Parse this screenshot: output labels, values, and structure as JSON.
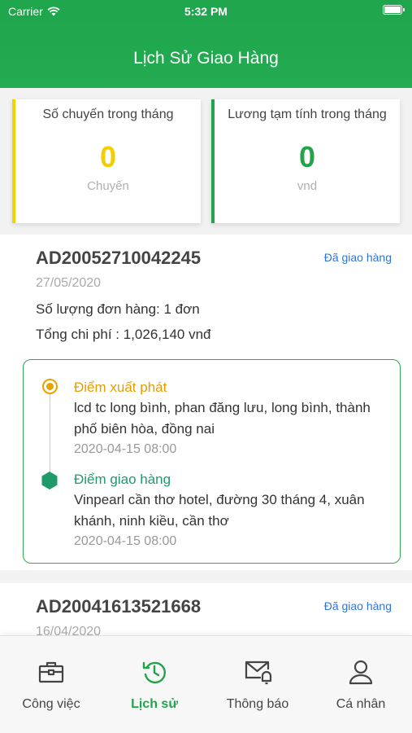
{
  "status_bar": {
    "carrier": "Carrier",
    "time": "5:32 PM"
  },
  "header": {
    "title": "Lịch Sử Giao Hàng"
  },
  "stats": {
    "trips": {
      "label": "Số chuyến trong tháng",
      "value": "0",
      "unit": "Chuyến"
    },
    "salary": {
      "label": "Lương tạm tính trong tháng",
      "value": "0",
      "unit": "vnd"
    }
  },
  "orders": [
    {
      "code": "AD20052710042245",
      "status": "Đã giao hàng",
      "date": "27/05/2020",
      "quantity": "Số lượng đơn hàng: 1 đơn",
      "cost": "Tổng chi phí : 1,026,140 vnđ",
      "origin": {
        "title": "Điểm xuất phát",
        "address": "lcd tc long bình, phan đăng lưu, long bình, thành phố biên hòa, đồng nai",
        "time": "2020-04-15 08:00"
      },
      "destination": {
        "title": "Điểm giao hàng",
        "address": "Vinpearl cần thơ hotel, đường 30 tháng 4, xuân khánh, ninh kiều, cần thơ",
        "time": "2020-04-15 08:00"
      }
    },
    {
      "code": "AD20041613521668",
      "status": "Đã giao hàng",
      "date": "16/04/2020"
    }
  ],
  "tabs": [
    {
      "label": "Công việc",
      "icon": "briefcase-icon",
      "active": false
    },
    {
      "label": "Lịch sử",
      "icon": "history-icon",
      "active": true
    },
    {
      "label": "Thông báo",
      "icon": "mail-bell-icon",
      "active": false
    },
    {
      "label": "Cá nhân",
      "icon": "user-icon",
      "active": false
    }
  ],
  "colors": {
    "primary": "#23a34b",
    "accent_yellow": "#f2cd00",
    "origin": "#e59d00",
    "destination": "#1f9a6b",
    "link": "#2f74d9"
  }
}
